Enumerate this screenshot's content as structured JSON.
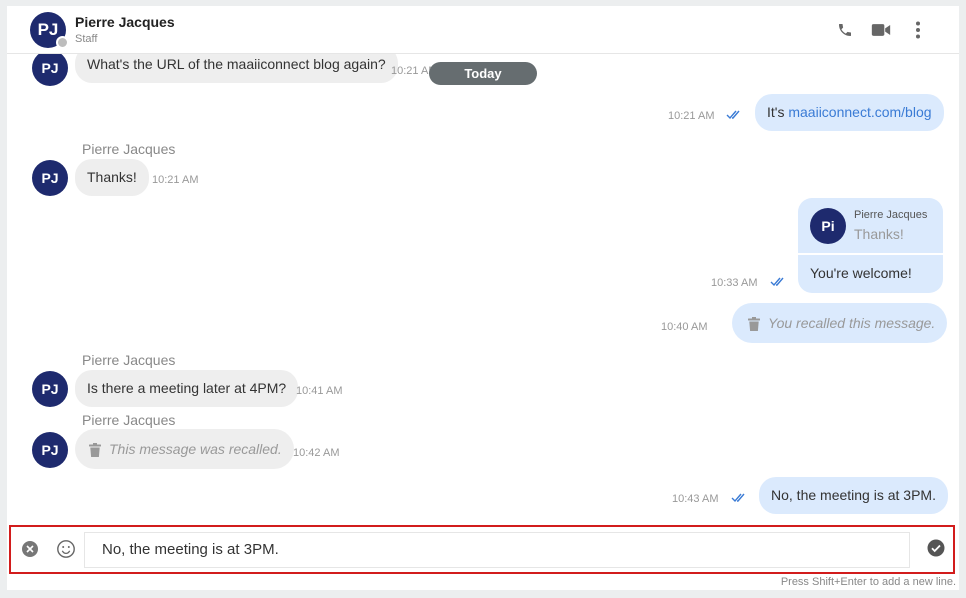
{
  "header": {
    "avatar_initials": "PJ",
    "name": "Pierre Jacques",
    "role": "Staff",
    "icons": [
      "phone-icon",
      "video-camera-icon",
      "more-vertical-icon"
    ]
  },
  "chat": {
    "date_separator": "Today",
    "messages": [
      {
        "direction": "in",
        "avatar": "PJ",
        "text": "What's the URL of the maaiiconnect blog again?",
        "time": "10:21 AM"
      },
      {
        "direction": "out",
        "text_prefix": "It's ",
        "link": "maaiiconnect.com/blog",
        "time": "10:21 AM",
        "status": "read"
      },
      {
        "direction": "in",
        "sender": "Pierre Jacques",
        "avatar": "PJ",
        "text": "Thanks!",
        "time": "10:21 AM"
      },
      {
        "direction": "out",
        "reply_to": {
          "avatar": "Pi",
          "sender": "Pierre Jacques",
          "text": "Thanks!"
        },
        "text": "You're welcome!",
        "time": "10:33 AM",
        "status": "read"
      },
      {
        "direction": "out",
        "recalled": true,
        "text": "You recalled this message.",
        "time": "10:40 AM"
      },
      {
        "direction": "in",
        "sender": "Pierre Jacques",
        "avatar": "PJ",
        "text": "Is there a meeting later at 4PM?",
        "time": "10:41 AM"
      },
      {
        "direction": "in",
        "sender": "Pierre Jacques",
        "avatar": "PJ",
        "recalled": true,
        "text": "This message was recalled.",
        "time": "10:42 AM"
      },
      {
        "direction": "out",
        "text": "No, the meeting is at 3PM.",
        "time": "10:43 AM",
        "status": "read"
      }
    ]
  },
  "composer": {
    "value": "No, the meeting is at 3PM.",
    "hint": "Press Shift+Enter to add a new line.",
    "icons": [
      "clear-icon",
      "emoji-icon",
      "send-icon"
    ]
  },
  "colors": {
    "avatar": "#1e2a6e",
    "incoming_bubble": "#eeeeee",
    "outgoing_bubble": "#dbeafd",
    "link": "#3a7bd5",
    "read_ticks": "#3a7bd5",
    "focus_border": "#d21c1c"
  }
}
